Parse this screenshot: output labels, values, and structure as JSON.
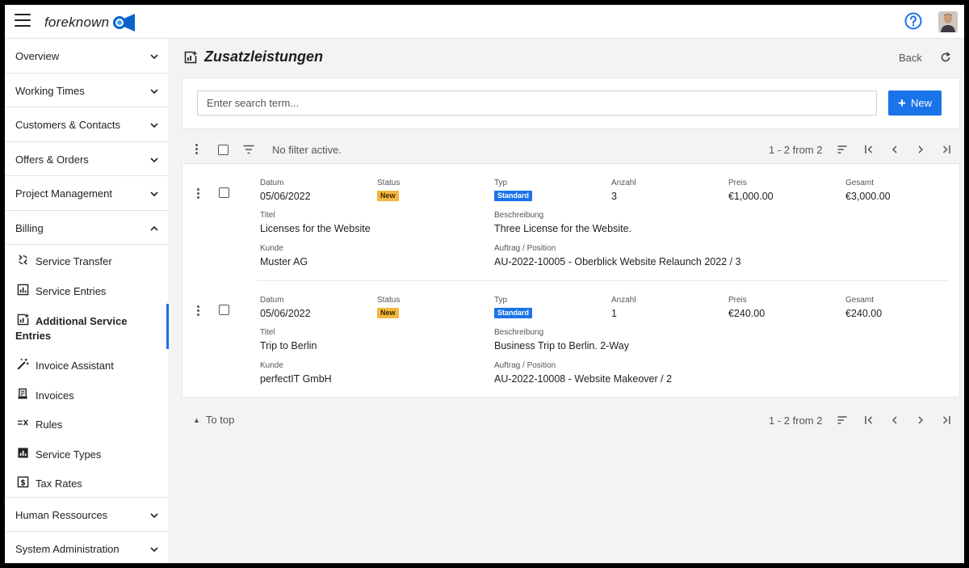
{
  "app": {
    "logo_text": "foreknown"
  },
  "sidebar": {
    "sections_top": [
      {
        "label": "Overview"
      },
      {
        "label": "Working Times"
      },
      {
        "label": "Customers & Contacts"
      },
      {
        "label": "Offers & Orders"
      },
      {
        "label": "Project Management"
      },
      {
        "label": "Billing"
      }
    ],
    "billing_items": [
      {
        "label": "Service Transfer",
        "icon": "transfer-icon"
      },
      {
        "label": "Service Entries",
        "icon": "chart-icon"
      },
      {
        "label": "Additional Service Entries",
        "icon": "chart-plus-icon"
      },
      {
        "label": "Invoice Assistant",
        "icon": "magic-wand-icon"
      },
      {
        "label": "Invoices",
        "icon": "receipt-icon"
      },
      {
        "label": "Rules",
        "icon": "rules-icon"
      },
      {
        "label": "Service Types",
        "icon": "bar-chart-icon"
      },
      {
        "label": "Tax Rates",
        "icon": "dollar-icon"
      }
    ],
    "sections_bottom": [
      {
        "label": "Human Ressources"
      },
      {
        "label": "System Administration"
      }
    ]
  },
  "page": {
    "title": "Zusatzleistungen",
    "back_label": "Back"
  },
  "search": {
    "placeholder": "Enter search term...",
    "value": "",
    "new_label": "New"
  },
  "toolbar": {
    "filter_text": "No filter active.",
    "pager_text": "1 - 2 from 2",
    "to_top_label": "To top"
  },
  "labels": {
    "datum": "Datum",
    "status": "Status",
    "typ": "Typ",
    "anzahl": "Anzahl",
    "preis": "Preis",
    "gesamt": "Gesamt",
    "titel": "Titel",
    "beschreibung": "Beschreibung",
    "kunde": "Kunde",
    "auftrag": "Auftrag / Position"
  },
  "entries": [
    {
      "datum": "05/06/2022",
      "status": "New",
      "typ": "Standard",
      "anzahl": "3",
      "preis": "€1,000.00",
      "gesamt": "€3,000.00",
      "titel": "Licenses for the Website",
      "beschreibung": "Three License for the Website.",
      "kunde": "Muster AG",
      "auftrag": "AU-2022-10005 - Oberblick Website Relaunch 2022 / 3"
    },
    {
      "datum": "05/06/2022",
      "status": "New",
      "typ": "Standard",
      "anzahl": "1",
      "preis": "€240.00",
      "gesamt": "€240.00",
      "titel": "Trip to Berlin",
      "beschreibung": "Business Trip to Berlin. 2-Way",
      "kunde": "perfectIT GmbH",
      "auftrag": "AU-2022-10008 - Website Makeover / 2"
    }
  ],
  "colors": {
    "accent": "#1a73e8",
    "badge_new": "#f4b740"
  }
}
